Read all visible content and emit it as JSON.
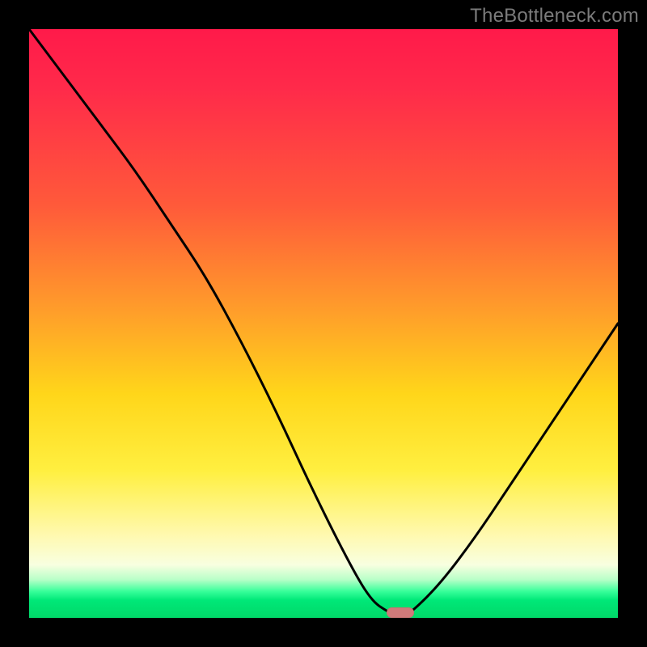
{
  "watermark": "TheBottleneck.com",
  "chart_data": {
    "type": "line",
    "title": "",
    "xlabel": "",
    "ylabel": "",
    "xlim": [
      0,
      100
    ],
    "ylim": [
      0,
      100
    ],
    "x": [
      0,
      6,
      12,
      18,
      24,
      30,
      36,
      42,
      48,
      54,
      58,
      61,
      63,
      65,
      70,
      76,
      82,
      88,
      94,
      100
    ],
    "values": [
      100,
      92,
      84,
      76,
      67,
      58,
      47,
      35,
      22,
      10,
      3,
      1,
      0,
      1,
      6,
      14,
      23,
      32,
      41,
      50
    ],
    "marker": {
      "x": 63,
      "y": 0
    },
    "gradient_stops": [
      {
        "pos": 0.0,
        "color": "#ff1a4a"
      },
      {
        "pos": 0.5,
        "color": "#ffc020"
      },
      {
        "pos": 0.85,
        "color": "#fff6a0"
      },
      {
        "pos": 0.96,
        "color": "#30ff90"
      },
      {
        "pos": 1.0,
        "color": "#00d868"
      }
    ]
  }
}
